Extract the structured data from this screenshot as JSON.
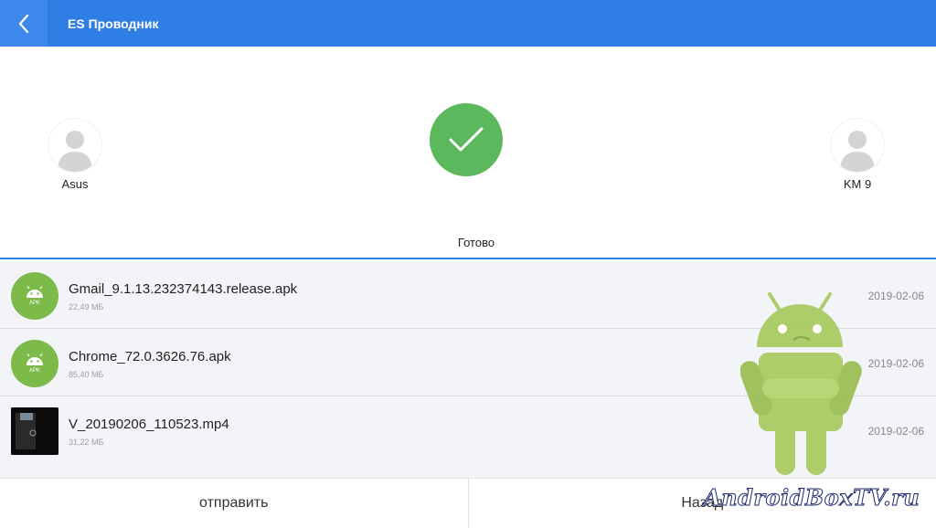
{
  "header": {
    "title": "ES Проводник",
    "back_icon": "chevron-left-icon",
    "bg_color": "#2f7ee6"
  },
  "transfer": {
    "sender": {
      "name": "Asus",
      "icon": "person-icon"
    },
    "receiver": {
      "name": "KM 9",
      "icon": "person-icon"
    },
    "status_icon": "checkmark-icon",
    "status_color": "#5cb85c",
    "status_text": "Готово"
  },
  "files": [
    {
      "name": "Gmail_9.1.13.232374143.release.apk",
      "size": "22,49 МБ",
      "date": "2019-02-06",
      "type": "apk",
      "icon_label": "APK"
    },
    {
      "name": "Chrome_72.0.3626.76.apk",
      "size": "85,40 МБ",
      "date": "2019-02-06",
      "type": "apk",
      "icon_label": "APK"
    },
    {
      "name": "V_20190206_110523.mp4",
      "size": "31,22 МБ",
      "date": "2019-02-06",
      "type": "video",
      "icon_label": ""
    }
  ],
  "footer": {
    "send_label": "отправить",
    "back_label": "Назад"
  },
  "watermark": {
    "text": "AndroidBoxTV.ru",
    "mascot": "android-robot-icon"
  }
}
